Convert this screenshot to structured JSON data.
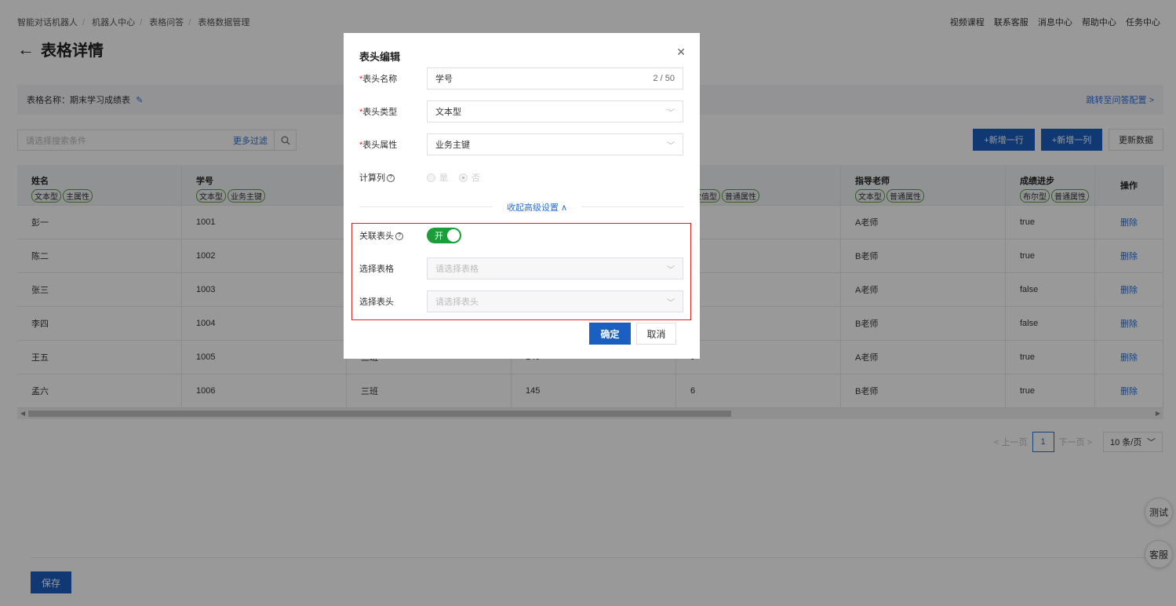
{
  "breadcrumb": [
    "智能对话机器人",
    "机器人中心",
    "表格问答",
    "表格数据管理"
  ],
  "top_links": [
    "视频课程",
    "联系客服",
    "消息中心",
    "帮助中心",
    "任务中心"
  ],
  "page_title": "表格详情",
  "table_name_label": "表格名称：期末学习成绩表",
  "jump_link": "跳转至问答配置 >",
  "filter": {
    "placeholder": "请选择搜索条件",
    "more": "更多过滤"
  },
  "buttons": {
    "add_row": "+新增一行",
    "add_col": "+新增一列",
    "refresh": "更新数据",
    "save": "保存"
  },
  "table": {
    "columns": [
      {
        "name": "姓名",
        "tags": [
          "文本型",
          "主属性"
        ]
      },
      {
        "name": "学号",
        "tags": [
          "文本型",
          "业务主键"
        ]
      },
      {
        "name": "",
        "tags": []
      },
      {
        "name": "",
        "tags": []
      },
      {
        "name": "名",
        "tags": [
          "数值型",
          "普通属性"
        ]
      },
      {
        "name": "指导老师",
        "tags": [
          "文本型",
          "普通属性"
        ]
      },
      {
        "name": "成绩进步",
        "tags": [
          "布尔型",
          "普通属性"
        ]
      },
      {
        "name": "操作",
        "tags": []
      }
    ],
    "rows": [
      [
        "彭一",
        "1001",
        "",
        "",
        "",
        "A老师",
        "true",
        "删除"
      ],
      [
        "陈二",
        "1002",
        "",
        "",
        "",
        "B老师",
        "true",
        "删除"
      ],
      [
        "张三",
        "1003",
        "",
        "",
        "",
        "A老师",
        "false",
        "删除"
      ],
      [
        "李四",
        "1004",
        "",
        "",
        "",
        "B老师",
        "false",
        "删除"
      ],
      [
        "王五",
        "1005",
        "三班",
        "140",
        "9",
        "A老师",
        "true",
        "删除"
      ],
      [
        "孟六",
        "1006",
        "三班",
        "145",
        "6",
        "B老师",
        "true",
        "删除"
      ]
    ]
  },
  "pager": {
    "prev": "< 上一页",
    "page": "1",
    "next": "下一页 >",
    "size": "10 条/页"
  },
  "float": {
    "test": "测试",
    "service": "客服"
  },
  "modal": {
    "title": "表头编辑",
    "name_label": "表头名称",
    "name_value": "学号",
    "name_count": "2 / 50",
    "type_label": "表头类型",
    "type_value": "文本型",
    "attr_label": "表头属性",
    "attr_value": "业务主键",
    "calc_label": "计算列",
    "calc_yes": "是",
    "calc_no": "否",
    "advanced": "收起高级设置 ∧",
    "link_label": "关联表头",
    "link_toggle": "开",
    "select_table_label": "选择表格",
    "select_table_placeholder": "请选择表格",
    "select_header_label": "选择表头",
    "select_header_placeholder": "请选择表头",
    "ok": "确定",
    "cancel": "取消"
  }
}
